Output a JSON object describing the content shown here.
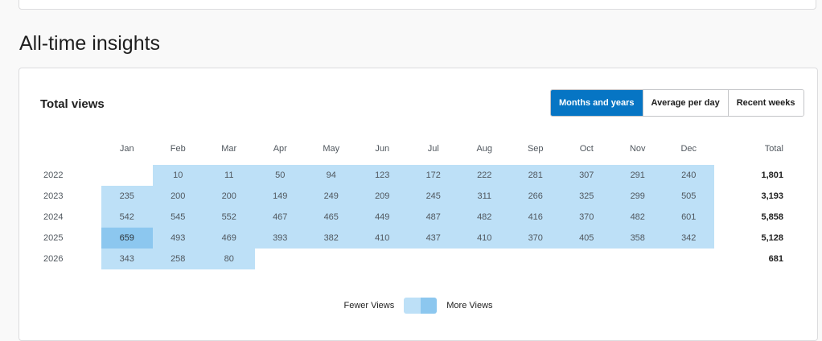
{
  "section_title": "All-time insights",
  "card": {
    "title": "Total views",
    "tabs": [
      {
        "label": "Months and years",
        "active": true
      },
      {
        "label": "Average per day",
        "active": false
      },
      {
        "label": "Recent weeks",
        "active": false
      }
    ]
  },
  "table": {
    "months": [
      "Jan",
      "Feb",
      "Mar",
      "Apr",
      "May",
      "Jun",
      "Jul",
      "Aug",
      "Sep",
      "Oct",
      "Nov",
      "Dec"
    ],
    "total_label": "Total",
    "rows": [
      {
        "year": "2022",
        "values": [
          null,
          10,
          11,
          50,
          94,
          123,
          172,
          222,
          281,
          307,
          291,
          240
        ],
        "total": "1,801"
      },
      {
        "year": "2023",
        "values": [
          235,
          200,
          200,
          149,
          249,
          209,
          245,
          311,
          266,
          325,
          299,
          505
        ],
        "total": "3,193"
      },
      {
        "year": "2024",
        "values": [
          542,
          545,
          552,
          467,
          465,
          449,
          487,
          482,
          416,
          370,
          482,
          601
        ],
        "total": "5,858"
      },
      {
        "year": "2025",
        "values": [
          659,
          493,
          469,
          393,
          382,
          410,
          437,
          410,
          370,
          405,
          358,
          342
        ],
        "total": "5,128"
      },
      {
        "year": "2026",
        "values": [
          343,
          258,
          80,
          null,
          null,
          null,
          null,
          null,
          null,
          null,
          null,
          null
        ],
        "total": "681"
      }
    ],
    "highlight_threshold": 650
  },
  "legend": {
    "fewer_label": "Fewer Views",
    "more_label": "More Views",
    "colors": {
      "low": "#bde0f7",
      "high": "#8cc7ef"
    }
  },
  "colors": {
    "accent": "#0675c4"
  }
}
